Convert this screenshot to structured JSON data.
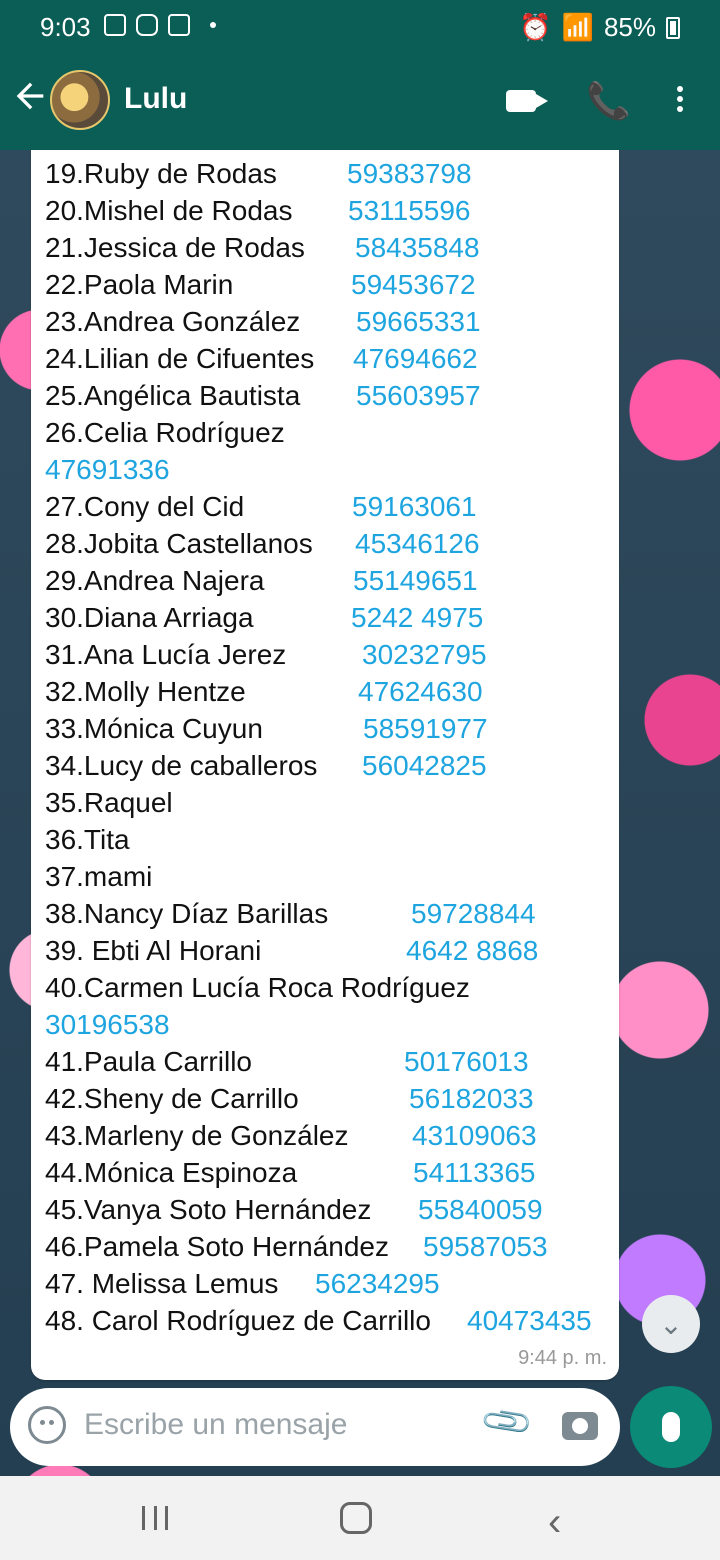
{
  "status_bar": {
    "time": "9:03",
    "battery": "85%"
  },
  "app_bar": {
    "contact_name": "Lulu"
  },
  "messages": [
    {
      "name": "19.Ruby de Rodas",
      "phone": "59383798"
    },
    {
      "name": "20.Mishel de Rodas",
      "phone": "53115596"
    },
    {
      "name": "21.Jessica de Rodas",
      "phone": "58435848"
    },
    {
      "name": "22.Paola Marin",
      "phone": "59453672"
    },
    {
      "name": "23.Andrea González",
      "phone": "59665331"
    },
    {
      "name": "24.Lilian de Cifuentes",
      "phone": "47694662"
    },
    {
      "name": "25.Angélica Bautista",
      "phone": "55603957"
    },
    {
      "name": "26.Celia Rodríguez",
      "phone": ""
    },
    {
      "name": "",
      "phone": "47691336"
    },
    {
      "name": "27.Cony del Cid",
      "phone": "59163061"
    },
    {
      "name": "28.Jobita Castellanos",
      "phone": "45346126"
    },
    {
      "name": "29.Andrea Najera",
      "phone": "55149651"
    },
    {
      "name": "30.Diana Arriaga",
      "phone": "5242 4975"
    },
    {
      "name": "31.Ana Lucía Jerez",
      "phone": "30232795"
    },
    {
      "name": "32.Molly  Hentze",
      "phone": "47624630"
    },
    {
      "name": "33.Mónica Cuyun",
      "phone": "58591977"
    },
    {
      "name": "34.Lucy de caballeros",
      "phone": "56042825"
    },
    {
      "name": "35.Raquel",
      "phone": ""
    },
    {
      "name": "36.Tita",
      "phone": ""
    },
    {
      "name": "37.mami",
      "phone": ""
    },
    {
      "name": "38.Nancy  Díaz Barillas",
      "phone": "59728844"
    },
    {
      "name": "39. Ebti Al Horani",
      "phone": "4642 8868"
    },
    {
      "name": "40.Carmen Lucía Roca Rodríguez",
      "phone": ""
    },
    {
      "name": "",
      "phone": "30196538"
    },
    {
      "name": "41.Paula Carrillo",
      "phone": "50176013"
    },
    {
      "name": "42.Sheny de Carrillo",
      "phone": "56182033"
    },
    {
      "name": "43.Marleny de González",
      "phone": "43109063"
    },
    {
      "name": "44.Mónica Espinoza",
      "phone": "54113365"
    },
    {
      "name": "45.Vanya Soto Hernández",
      "phone": "55840059"
    },
    {
      "name": "46.Pamela Soto Hernández",
      "phone": "59587053"
    },
    {
      "name": "47. Melissa Lemus",
      "phone": "56234295"
    },
    {
      "name": "48. Carol Rodríguez de Carrillo",
      "phone": "40473435"
    }
  ],
  "timestamp": "9:44 p. m.",
  "composer": {
    "placeholder": "Escribe un mensaje"
  },
  "icons": {
    "back": "back-arrow-icon",
    "video": "video-call-icon",
    "call": "phone-call-icon",
    "menu": "more-vert-icon",
    "emoji": "emoji-icon",
    "attach": "attach-icon",
    "camera": "camera-icon",
    "mic": "mic-icon",
    "scroll": "chevrons-down-icon"
  }
}
